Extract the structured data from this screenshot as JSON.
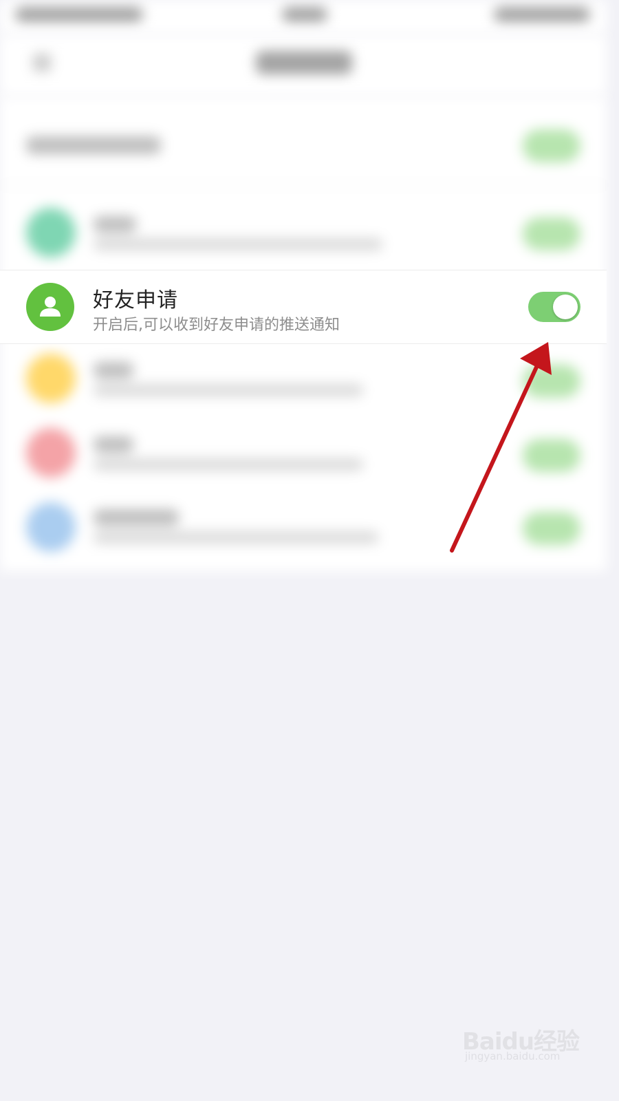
{
  "friend_request": {
    "title": "好友申请",
    "description": "开启后,可以收到好友申请的推送通知",
    "enabled": true
  },
  "colors": {
    "avatar_green": "#62c13f",
    "switch_on": "#7dcf73",
    "annotation_arrow": "#c4161c",
    "background": "#f2f2f7"
  },
  "icons": {
    "avatar": "person-icon",
    "annotation": "red-arrow"
  },
  "watermark": {
    "main": "Baidu经验",
    "sub": "jingyan.baidu.com"
  }
}
